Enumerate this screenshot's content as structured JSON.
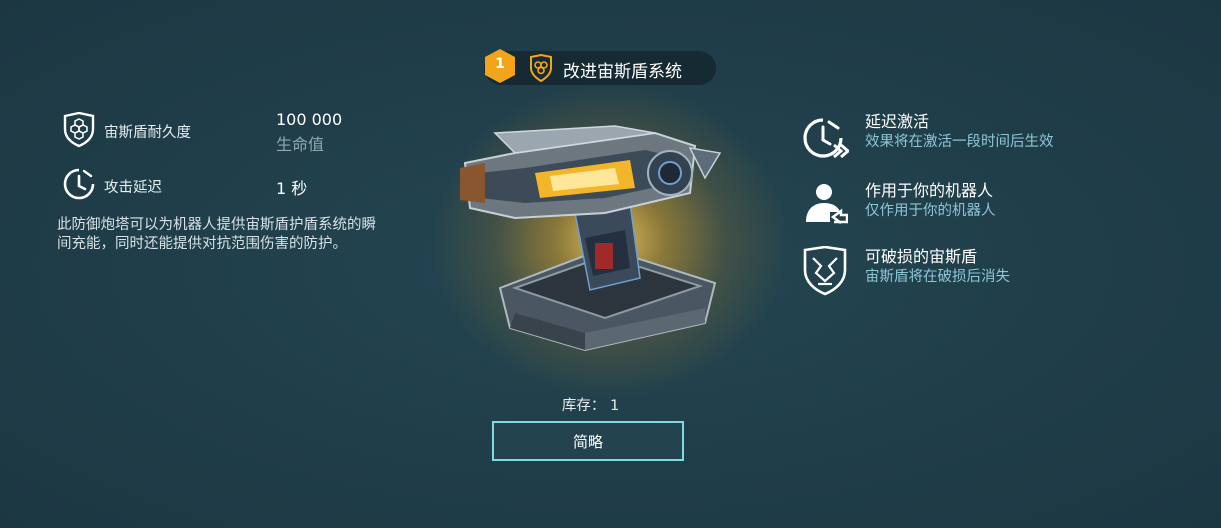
{
  "header": {
    "tier": "1",
    "title": "改进宙斯盾系统"
  },
  "stats": [
    {
      "icon": "shield-hexagon-icon",
      "label": "宙斯盾耐久度",
      "value": "100 000",
      "sub": "生命值"
    },
    {
      "icon": "clock-delay-icon",
      "label": "攻击延迟",
      "value": "1 秒",
      "sub": ""
    }
  ],
  "description": "此防御炮塔可以为机器人提供宙斯盾护盾系统的瞬间充能，同时还能提供对抗范围伤害的防护。",
  "stock": {
    "label": "库存：",
    "value": "1"
  },
  "brief_button": "简略",
  "features": [
    {
      "icon": "delayed-activation-icon",
      "title": "延迟激活",
      "desc": "效果将在激活一段时间后生效"
    },
    {
      "icon": "robot-user-icon",
      "title": "作用于你的机器人",
      "desc": "仅作用于你的机器人"
    },
    {
      "icon": "broken-shield-icon",
      "title": "可破损的宙斯盾",
      "desc": "宙斯盾将在破损后消失"
    }
  ],
  "colors": {
    "background": "#1f3d49",
    "accent": "#7fd9e0",
    "tier_badge": "#f2a51a",
    "feature_desc": "#8fc6d6"
  }
}
